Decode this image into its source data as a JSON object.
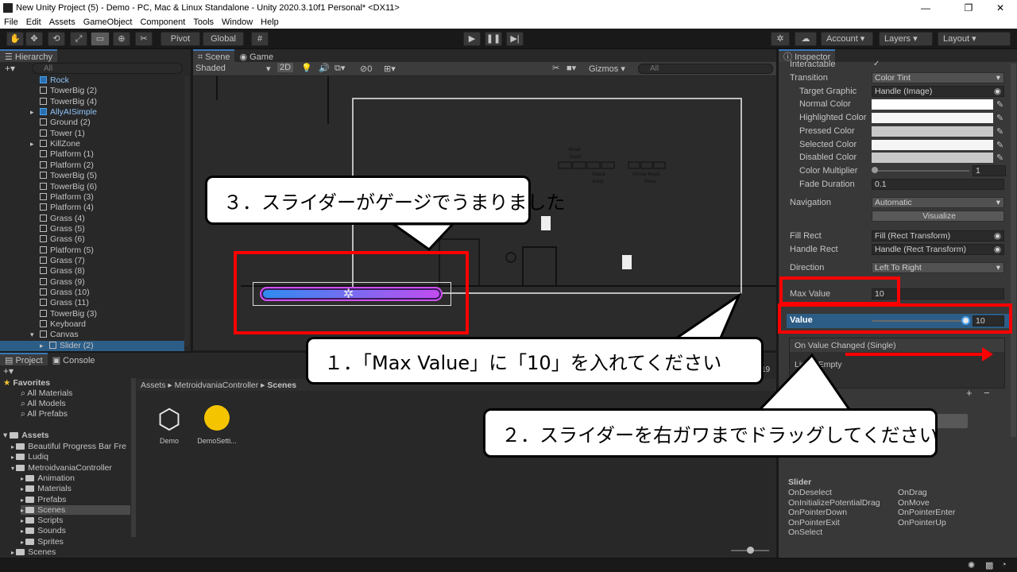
{
  "window": {
    "title": "New Unity Project (5) - Demo - PC, Mac & Linux Standalone - Unity 2020.3.10f1 Personal* <DX11>",
    "minimize": "—",
    "maximize": "❐",
    "close": "✕"
  },
  "menu": [
    "File",
    "Edit",
    "Assets",
    "GameObject",
    "Component",
    "Tools",
    "Window",
    "Help"
  ],
  "toolbar": {
    "pivot": "Pivot",
    "global": "Global",
    "account": "Account",
    "layers": "Layers",
    "layout": "Layout"
  },
  "hierarchy": {
    "tab": "Hierarchy",
    "search_placeholder": "All",
    "items": [
      {
        "label": "Rock",
        "blue": true
      },
      {
        "label": "TowerBig (2)"
      },
      {
        "label": "TowerBig (4)"
      },
      {
        "label": "AllyAISimple",
        "blue": true
      },
      {
        "label": "Ground (2)"
      },
      {
        "label": "Tower (1)"
      },
      {
        "label": "KillZone"
      },
      {
        "label": "Platform (1)"
      },
      {
        "label": "Platform (2)"
      },
      {
        "label": "TowerBig (5)"
      },
      {
        "label": "TowerBig (6)"
      },
      {
        "label": "Platform (3)"
      },
      {
        "label": "Platform (4)"
      },
      {
        "label": "Grass (4)"
      },
      {
        "label": "Grass (5)"
      },
      {
        "label": "Grass (6)"
      },
      {
        "label": "Platform (5)"
      },
      {
        "label": "Grass (7)"
      },
      {
        "label": "Grass (8)"
      },
      {
        "label": "Grass (9)"
      },
      {
        "label": "Grass (10)"
      },
      {
        "label": "Grass (11)"
      },
      {
        "label": "TowerBig (3)"
      },
      {
        "label": "Keyboard"
      },
      {
        "label": "Canvas"
      },
      {
        "label": "Slider (2)"
      }
    ]
  },
  "scene": {
    "tab_scene": "Scene",
    "tab_game": "Game",
    "shading": "Shaded",
    "mode2d": "2D",
    "fx_count": "0",
    "gizmos": "Gizmos",
    "search_placeholder": "All",
    "hud_shoot": "Shoot",
    "hud_dash": "Dash",
    "hud_attack": "Attack",
    "hud_jump": "Jump",
    "hud_arrow": "(Arrow Keys)",
    "hud_move": "Move"
  },
  "inspector": {
    "tab": "Inspector",
    "interactable_label": "Interactable",
    "transition_label": "Transition",
    "transition_value": "Color Tint",
    "target_graphic_label": "Target Graphic",
    "target_graphic_value": "Handle (Image)",
    "normal_color": "Normal Color",
    "highlighted_color": "Highlighted Color",
    "pressed_color": "Pressed Color",
    "selected_color": "Selected Color",
    "disabled_color": "Disabled Color",
    "color_multiplier_label": "Color Multiplier",
    "color_multiplier_value": "1",
    "fade_duration_label": "Fade Duration",
    "fade_duration_value": "0.1",
    "navigation_label": "Navigation",
    "navigation_value": "Automatic",
    "visualize": "Visualize",
    "fill_rect_label": "Fill Rect",
    "fill_rect_value": "Fill (Rect Transform)",
    "handle_rect_label": "Handle Rect",
    "handle_rect_value": "Handle (Rect Transform)",
    "direction_label": "Direction",
    "direction_value": "Left To Right",
    "max_value_label": "Max Value",
    "max_value": "10",
    "value_label": "Value",
    "value": "10",
    "value_fraction": 1.0,
    "on_value_changed": "On Value Changed (Single)",
    "list_empty": "List is Empty",
    "slider_events_title": "Slider",
    "events_left": [
      "OnDeselect",
      "OnInitializePotentialDrag",
      "OnPointerDown",
      "OnPointerExit",
      "OnSelect"
    ],
    "events_right": [
      "OnDrag",
      "OnMove",
      "OnPointerEnter",
      "OnPointerUp"
    ]
  },
  "project": {
    "tab_project": "Project",
    "tab_console": "Console",
    "favorites": "Favorites",
    "fav_items": [
      "All Materials",
      "All Models",
      "All Prefabs"
    ],
    "assets": "Assets",
    "tree": [
      {
        "label": "Beautiful Progress Bar Fre",
        "indent": 1
      },
      {
        "label": "Ludiq",
        "indent": 1
      },
      {
        "label": "MetroidvaniaController",
        "indent": 1
      },
      {
        "label": "Animation",
        "indent": 2
      },
      {
        "label": "Materials",
        "indent": 2
      },
      {
        "label": "Prefabs",
        "indent": 2
      },
      {
        "label": "Scenes",
        "indent": 2,
        "selected": true
      },
      {
        "label": "Scripts",
        "indent": 2
      },
      {
        "label": "Sounds",
        "indent": 2
      },
      {
        "label": "Sprites",
        "indent": 2
      },
      {
        "label": "Scenes",
        "indent": 1
      }
    ],
    "breadcrumb": [
      "Assets",
      "MetroidvaniaController",
      "Scenes"
    ],
    "files": [
      "Demo",
      "DemoSetti..."
    ],
    "count": "19"
  },
  "callouts": {
    "step1": "１．「Max Value」に「10」を入れてください",
    "step2": "２．スライダーを右ガワまでドラッグしてください",
    "step3": "３．スライダーがゲージでうまりました"
  },
  "colors": {
    "accent_red": "#ff0000",
    "selection_blue": "#3a79bb",
    "slider_gradient_start": "#2e8cf0",
    "slider_gradient_end": "#c24cf0"
  }
}
